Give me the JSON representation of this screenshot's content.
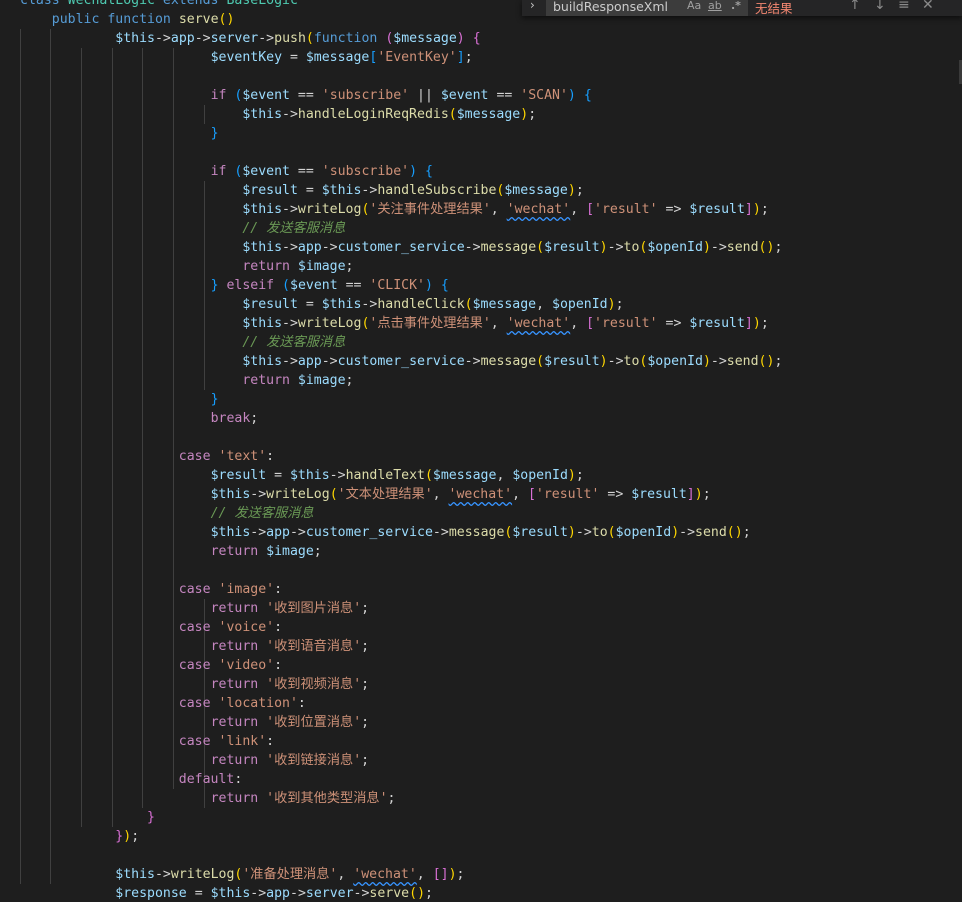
{
  "find_widget": {
    "toggle_icon": "chevron-right-icon",
    "query": "buildResponseXml",
    "match_case_label": "Aa",
    "whole_word_label": "ab",
    "regex_label": ".*",
    "result_text": "无结果",
    "prev_icon": "arrow-up-icon",
    "next_icon": "arrow-down-icon",
    "selection_icon": "find-in-selection-icon",
    "close_icon": "close-icon"
  },
  "colors": {
    "background": "#1e1e1e",
    "keyword": "#569cd6",
    "control": "#c586c0",
    "function": "#dcdcaa",
    "variable": "#9cdcfe",
    "string": "#ce9178",
    "comment": "#6a9955",
    "no_result": "#f48771"
  },
  "code_lines": [
    [
      [
        "kw",
        "class "
      ],
      [
        "cls",
        "WechatLogic "
      ],
      [
        "kw",
        "extends "
      ],
      [
        "cls",
        "BaseLogic"
      ]
    ],
    [
      [
        "p",
        "    "
      ],
      [
        "kw",
        "public "
      ],
      [
        "kw",
        "function "
      ],
      [
        "fn",
        "serve"
      ],
      [
        "b1",
        "()"
      ]
    ],
    [
      [
        "p",
        "            "
      ],
      [
        "var",
        "$this"
      ],
      [
        "p",
        "->"
      ],
      [
        "prp",
        "app"
      ],
      [
        "p",
        "->"
      ],
      [
        "prp",
        "server"
      ],
      [
        "p",
        "->"
      ],
      [
        "fn",
        "push"
      ],
      [
        "b1",
        "("
      ],
      [
        "kw",
        "function "
      ],
      [
        "b2",
        "("
      ],
      [
        "var",
        "$message"
      ],
      [
        "b2",
        ")"
      ],
      [
        "p",
        " "
      ],
      [
        "b2",
        "{"
      ]
    ],
    [
      [
        "p",
        "                        "
      ],
      [
        "var",
        "$eventKey"
      ],
      [
        "p",
        " = "
      ],
      [
        "var",
        "$message"
      ],
      [
        "b3",
        "["
      ],
      [
        "str",
        "'EventKey'"
      ],
      [
        "b3",
        "]"
      ],
      [
        "p",
        ";"
      ]
    ],
    [],
    [
      [
        "p",
        "                        "
      ],
      [
        "ctl",
        "if "
      ],
      [
        "b3",
        "("
      ],
      [
        "var",
        "$event"
      ],
      [
        "p",
        " == "
      ],
      [
        "str",
        "'subscribe'"
      ],
      [
        "p",
        " || "
      ],
      [
        "var",
        "$event"
      ],
      [
        "p",
        " == "
      ],
      [
        "str",
        "'SCAN'"
      ],
      [
        "b3",
        ")"
      ],
      [
        "p",
        " "
      ],
      [
        "b3",
        "{"
      ]
    ],
    [
      [
        "p",
        "                            "
      ],
      [
        "var",
        "$this"
      ],
      [
        "p",
        "->"
      ],
      [
        "fn",
        "handleLoginReqRedis"
      ],
      [
        "b1",
        "("
      ],
      [
        "var",
        "$message"
      ],
      [
        "b1",
        ")"
      ],
      [
        "p",
        ";"
      ]
    ],
    [
      [
        "p",
        "                        "
      ],
      [
        "b3",
        "}"
      ]
    ],
    [],
    [
      [
        "p",
        "                        "
      ],
      [
        "ctl",
        "if "
      ],
      [
        "b3",
        "("
      ],
      [
        "var",
        "$event"
      ],
      [
        "p",
        " == "
      ],
      [
        "str",
        "'subscribe'"
      ],
      [
        "b3",
        ")"
      ],
      [
        "p",
        " "
      ],
      [
        "b3",
        "{"
      ]
    ],
    [
      [
        "p",
        "                            "
      ],
      [
        "var",
        "$result"
      ],
      [
        "p",
        " = "
      ],
      [
        "var",
        "$this"
      ],
      [
        "p",
        "->"
      ],
      [
        "fn",
        "handleSubscribe"
      ],
      [
        "b1",
        "("
      ],
      [
        "var",
        "$message"
      ],
      [
        "b1",
        ")"
      ],
      [
        "p",
        ";"
      ]
    ],
    [
      [
        "p",
        "                            "
      ],
      [
        "var",
        "$this"
      ],
      [
        "p",
        "->"
      ],
      [
        "fn",
        "writeLog"
      ],
      [
        "b1",
        "("
      ],
      [
        "str",
        "'关注事件处理结果'"
      ],
      [
        "p",
        ", "
      ],
      [
        "strsq",
        "'wechat'"
      ],
      [
        "p",
        ", "
      ],
      [
        "b2",
        "["
      ],
      [
        "str",
        "'result'"
      ],
      [
        "p",
        " => "
      ],
      [
        "var",
        "$result"
      ],
      [
        "b2",
        "]"
      ],
      [
        "b1",
        ")"
      ],
      [
        "p",
        ";"
      ]
    ],
    [
      [
        "p",
        "                            "
      ],
      [
        "cm",
        "// 发送客服消息"
      ]
    ],
    [
      [
        "p",
        "                            "
      ],
      [
        "var",
        "$this"
      ],
      [
        "p",
        "->"
      ],
      [
        "prp",
        "app"
      ],
      [
        "p",
        "->"
      ],
      [
        "prp",
        "customer_service"
      ],
      [
        "p",
        "->"
      ],
      [
        "fn",
        "message"
      ],
      [
        "b1",
        "("
      ],
      [
        "var",
        "$result"
      ],
      [
        "b1",
        ")"
      ],
      [
        "p",
        "->"
      ],
      [
        "fn",
        "to"
      ],
      [
        "b1",
        "("
      ],
      [
        "var",
        "$openId"
      ],
      [
        "b1",
        ")"
      ],
      [
        "p",
        "->"
      ],
      [
        "fn",
        "send"
      ],
      [
        "b1",
        "()"
      ],
      [
        "p",
        ";"
      ]
    ],
    [
      [
        "p",
        "                            "
      ],
      [
        "ctl",
        "return "
      ],
      [
        "var",
        "$image"
      ],
      [
        "p",
        ";"
      ]
    ],
    [
      [
        "p",
        "                        "
      ],
      [
        "b3",
        "}"
      ],
      [
        "p",
        " "
      ],
      [
        "ctl",
        "elseif "
      ],
      [
        "b3",
        "("
      ],
      [
        "var",
        "$event"
      ],
      [
        "p",
        " == "
      ],
      [
        "str",
        "'CLICK'"
      ],
      [
        "b3",
        ")"
      ],
      [
        "p",
        " "
      ],
      [
        "b3",
        "{"
      ]
    ],
    [
      [
        "p",
        "                            "
      ],
      [
        "var",
        "$result"
      ],
      [
        "p",
        " = "
      ],
      [
        "var",
        "$this"
      ],
      [
        "p",
        "->"
      ],
      [
        "fn",
        "handleClick"
      ],
      [
        "b1",
        "("
      ],
      [
        "var",
        "$message"
      ],
      [
        "p",
        ", "
      ],
      [
        "var",
        "$openId"
      ],
      [
        "b1",
        ")"
      ],
      [
        "p",
        ";"
      ]
    ],
    [
      [
        "p",
        "                            "
      ],
      [
        "var",
        "$this"
      ],
      [
        "p",
        "->"
      ],
      [
        "fn",
        "writeLog"
      ],
      [
        "b1",
        "("
      ],
      [
        "str",
        "'点击事件处理结果'"
      ],
      [
        "p",
        ", "
      ],
      [
        "strsq",
        "'wechat'"
      ],
      [
        "p",
        ", "
      ],
      [
        "b2",
        "["
      ],
      [
        "str",
        "'result'"
      ],
      [
        "p",
        " => "
      ],
      [
        "var",
        "$result"
      ],
      [
        "b2",
        "]"
      ],
      [
        "b1",
        ")"
      ],
      [
        "p",
        ";"
      ]
    ],
    [
      [
        "p",
        "                            "
      ],
      [
        "cm",
        "// 发送客服消息"
      ]
    ],
    [
      [
        "p",
        "                            "
      ],
      [
        "var",
        "$this"
      ],
      [
        "p",
        "->"
      ],
      [
        "prp",
        "app"
      ],
      [
        "p",
        "->"
      ],
      [
        "prp",
        "customer_service"
      ],
      [
        "p",
        "->"
      ],
      [
        "fn",
        "message"
      ],
      [
        "b1",
        "("
      ],
      [
        "var",
        "$result"
      ],
      [
        "b1",
        ")"
      ],
      [
        "p",
        "->"
      ],
      [
        "fn",
        "to"
      ],
      [
        "b1",
        "("
      ],
      [
        "var",
        "$openId"
      ],
      [
        "b1",
        ")"
      ],
      [
        "p",
        "->"
      ],
      [
        "fn",
        "send"
      ],
      [
        "b1",
        "()"
      ],
      [
        "p",
        ";"
      ]
    ],
    [
      [
        "p",
        "                            "
      ],
      [
        "ctl",
        "return "
      ],
      [
        "var",
        "$image"
      ],
      [
        "p",
        ";"
      ]
    ],
    [
      [
        "p",
        "                        "
      ],
      [
        "b3",
        "}"
      ]
    ],
    [
      [
        "p",
        "                        "
      ],
      [
        "ctl",
        "break"
      ],
      [
        "p",
        ";"
      ]
    ],
    [],
    [
      [
        "p",
        "                    "
      ],
      [
        "ctl",
        "case "
      ],
      [
        "str",
        "'text'"
      ],
      [
        "p",
        ":"
      ]
    ],
    [
      [
        "p",
        "                        "
      ],
      [
        "var",
        "$result"
      ],
      [
        "p",
        " = "
      ],
      [
        "var",
        "$this"
      ],
      [
        "p",
        "->"
      ],
      [
        "fn",
        "handleText"
      ],
      [
        "b1",
        "("
      ],
      [
        "var",
        "$message"
      ],
      [
        "p",
        ", "
      ],
      [
        "var",
        "$openId"
      ],
      [
        "b1",
        ")"
      ],
      [
        "p",
        ";"
      ]
    ],
    [
      [
        "p",
        "                        "
      ],
      [
        "var",
        "$this"
      ],
      [
        "p",
        "->"
      ],
      [
        "fn",
        "writeLog"
      ],
      [
        "b1",
        "("
      ],
      [
        "str",
        "'文本处理结果'"
      ],
      [
        "p",
        ", "
      ],
      [
        "strsq",
        "'wechat'"
      ],
      [
        "p",
        ", "
      ],
      [
        "b2",
        "["
      ],
      [
        "str",
        "'result'"
      ],
      [
        "p",
        " => "
      ],
      [
        "var",
        "$result"
      ],
      [
        "b2",
        "]"
      ],
      [
        "b1",
        ")"
      ],
      [
        "p",
        ";"
      ]
    ],
    [
      [
        "p",
        "                        "
      ],
      [
        "cm",
        "// 发送客服消息"
      ]
    ],
    [
      [
        "p",
        "                        "
      ],
      [
        "var",
        "$this"
      ],
      [
        "p",
        "->"
      ],
      [
        "prp",
        "app"
      ],
      [
        "p",
        "->"
      ],
      [
        "prp",
        "customer_service"
      ],
      [
        "p",
        "->"
      ],
      [
        "fn",
        "message"
      ],
      [
        "b1",
        "("
      ],
      [
        "var",
        "$result"
      ],
      [
        "b1",
        ")"
      ],
      [
        "p",
        "->"
      ],
      [
        "fn",
        "to"
      ],
      [
        "b1",
        "("
      ],
      [
        "var",
        "$openId"
      ],
      [
        "b1",
        ")"
      ],
      [
        "p",
        "->"
      ],
      [
        "fn",
        "send"
      ],
      [
        "b1",
        "()"
      ],
      [
        "p",
        ";"
      ]
    ],
    [
      [
        "p",
        "                        "
      ],
      [
        "ctl",
        "return "
      ],
      [
        "var",
        "$image"
      ],
      [
        "p",
        ";"
      ]
    ],
    [],
    [
      [
        "p",
        "                    "
      ],
      [
        "ctl",
        "case "
      ],
      [
        "str",
        "'image'"
      ],
      [
        "p",
        ":"
      ]
    ],
    [
      [
        "p",
        "                        "
      ],
      [
        "ctl",
        "return "
      ],
      [
        "str",
        "'收到图片消息'"
      ],
      [
        "p",
        ";"
      ]
    ],
    [
      [
        "p",
        "                    "
      ],
      [
        "ctl",
        "case "
      ],
      [
        "str",
        "'voice'"
      ],
      [
        "p",
        ":"
      ]
    ],
    [
      [
        "p",
        "                        "
      ],
      [
        "ctl",
        "return "
      ],
      [
        "str",
        "'收到语音消息'"
      ],
      [
        "p",
        ";"
      ]
    ],
    [
      [
        "p",
        "                    "
      ],
      [
        "ctl",
        "case "
      ],
      [
        "str",
        "'video'"
      ],
      [
        "p",
        ":"
      ]
    ],
    [
      [
        "p",
        "                        "
      ],
      [
        "ctl",
        "return "
      ],
      [
        "str",
        "'收到视频消息'"
      ],
      [
        "p",
        ";"
      ]
    ],
    [
      [
        "p",
        "                    "
      ],
      [
        "ctl",
        "case "
      ],
      [
        "str",
        "'location'"
      ],
      [
        "p",
        ":"
      ]
    ],
    [
      [
        "p",
        "                        "
      ],
      [
        "ctl",
        "return "
      ],
      [
        "str",
        "'收到位置消息'"
      ],
      [
        "p",
        ";"
      ]
    ],
    [
      [
        "p",
        "                    "
      ],
      [
        "ctl",
        "case "
      ],
      [
        "str",
        "'link'"
      ],
      [
        "p",
        ":"
      ]
    ],
    [
      [
        "p",
        "                        "
      ],
      [
        "ctl",
        "return "
      ],
      [
        "str",
        "'收到链接消息'"
      ],
      [
        "p",
        ";"
      ]
    ],
    [
      [
        "p",
        "                    "
      ],
      [
        "ctl",
        "default"
      ],
      [
        "p",
        ":"
      ]
    ],
    [
      [
        "p",
        "                        "
      ],
      [
        "ctl",
        "return "
      ],
      [
        "str",
        "'收到其他类型消息'"
      ],
      [
        "p",
        ";"
      ]
    ],
    [
      [
        "p",
        "                "
      ],
      [
        "b2",
        "}"
      ]
    ],
    [
      [
        "p",
        "            "
      ],
      [
        "b2",
        "}"
      ],
      [
        "b1",
        ")"
      ],
      [
        "p",
        ";"
      ]
    ],
    [],
    [
      [
        "p",
        "            "
      ],
      [
        "var",
        "$this"
      ],
      [
        "p",
        "->"
      ],
      [
        "fn",
        "writeLog"
      ],
      [
        "b1",
        "("
      ],
      [
        "str",
        "'准备处理消息'"
      ],
      [
        "p",
        ", "
      ],
      [
        "strsq",
        "'wechat'"
      ],
      [
        "p",
        ", "
      ],
      [
        "b2",
        "[]"
      ],
      [
        "b1",
        ")"
      ],
      [
        "p",
        ";"
      ]
    ],
    [
      [
        "p",
        "            "
      ],
      [
        "var",
        "$response"
      ],
      [
        "p",
        " = "
      ],
      [
        "var",
        "$this"
      ],
      [
        "p",
        "->"
      ],
      [
        "prp",
        "app"
      ],
      [
        "p",
        "->"
      ],
      [
        "prp",
        "server"
      ],
      [
        "p",
        "->"
      ],
      [
        "fn",
        "serve"
      ],
      [
        "b1",
        "()"
      ],
      [
        "p",
        ";"
      ]
    ]
  ]
}
